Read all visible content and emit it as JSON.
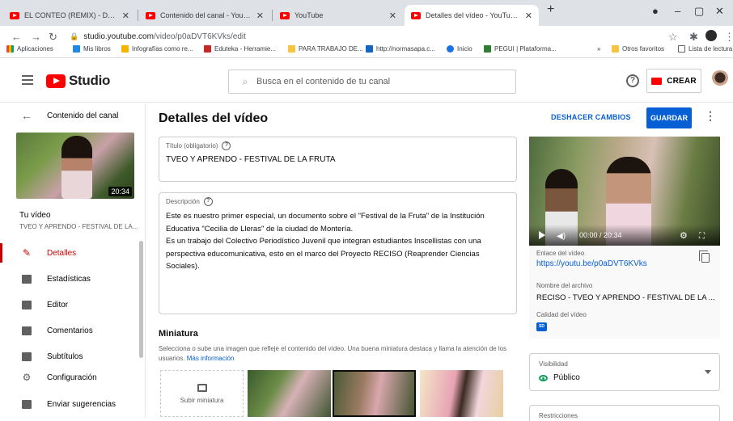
{
  "browser": {
    "tabs": [
      {
        "label": "EL CONTEO (REMIX) - DANDY BI",
        "active": false
      },
      {
        "label": "Contenido del canal - YouTube S",
        "active": false
      },
      {
        "label": "YouTube",
        "active": false
      },
      {
        "label": "Detalles del vídeo - YouTube Stu",
        "active": true
      }
    ],
    "new_tab": "+",
    "url_host": "studio.youtube.com",
    "url_path": "/video/p0aDVT6KVks/edit",
    "bookmarks": [
      {
        "label": "Aplicaciones",
        "color": "#e8453c"
      },
      {
        "label": "Mis libros",
        "color": "#1e88e5"
      },
      {
        "label": "Infografías como re...",
        "color": "#f4b400"
      },
      {
        "label": "Eduteka - Herramie...",
        "color": "#c62828"
      },
      {
        "label": "PARA TRABAJO DE...",
        "color": "#f6c342"
      },
      {
        "label": "http://normasapa.c...",
        "color": "#1565c0"
      },
      {
        "label": "Inicio",
        "color": "#1a73e8"
      },
      {
        "label": "PEGUI | Plataforma...",
        "color": "#2e7d32"
      },
      {
        "label": "»",
        "color": ""
      },
      {
        "label": "Otros favoritos",
        "color": "#f6c342"
      },
      {
        "label": "Lista de lectura",
        "color": "#5f6368"
      }
    ]
  },
  "header": {
    "logo_text": "Studio",
    "search_placeholder": "Busca en el contenido de tu canal",
    "help_icon": "?",
    "create_label": "CREAR"
  },
  "sidebar": {
    "back_label": "Contenido del canal",
    "thumb_duration": "20:34",
    "your_video_label": "Tu vídeo",
    "video_title_short": "TVEO Y APRENDO - FESTIVAL DE LA...",
    "items": [
      {
        "label": "Detalles",
        "icon": "pencil-icon",
        "active": true
      },
      {
        "label": "Estadísticas",
        "icon": "analytics-icon",
        "active": false
      },
      {
        "label": "Editor",
        "icon": "editor-icon",
        "active": false
      },
      {
        "label": "Comentarios",
        "icon": "comments-icon",
        "active": false
      },
      {
        "label": "Subtítulos",
        "icon": "subtitles-icon",
        "active": false
      }
    ],
    "settings_label": "Configuración",
    "feedback_label": "Enviar sugerencias"
  },
  "main": {
    "page_title": "Detalles del vídeo",
    "undo_label": "DESHACER CAMBIOS",
    "save_label": "GUARDAR",
    "title_field_label": "Título (obligatorio)",
    "title_value": "TVEO Y APRENDO - FESTIVAL DE LA FRUTA",
    "desc_field_label": "Descripción",
    "desc_value": "Este es nuestro primer especial, un documento sobre el \"Festival de la Fruta\" de la Institución\nEducativa \"Cecilia de Lleras\" de la ciudad de Montería.\nEs un trabajo del Colectivo Periodístico Juvenil que integran estudiantes Inscellistas con una\nperspectiva educomunicativa, esto en el marco del Proyecto RECISO (Reaprender Ciencias\nSociales).",
    "thumbnail_heading": "Miniatura",
    "thumbnail_desc": "Selecciona o sube una imagen que refleje el contenido del vídeo. Una buena miniatura destaca y llama la atención de los usuarios.",
    "thumbnail_more": "Más información",
    "upload_label": "Subir miniatura"
  },
  "panel": {
    "player_time": "00:00 / 20:34",
    "link_label": "Enlace del vídeo",
    "link_value": "https://youtu.be/p0aDVT6KVks",
    "file_label": "Nombre del archivo",
    "file_value": "RECISO - TVEO Y APRENDO - FESTIVAL DE LA ...",
    "quality_label": "Calidad del vídeo",
    "quality_badge": "SD",
    "visibility_label": "Visibilidad",
    "visibility_value": "Público",
    "restrictions_label": "Restricciones"
  }
}
